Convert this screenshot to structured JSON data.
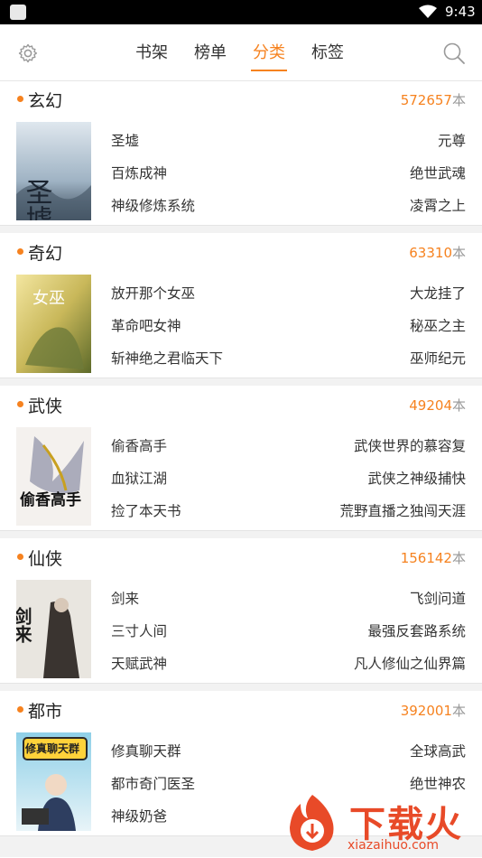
{
  "status_bar": {
    "time": "9:43"
  },
  "nav": {
    "tabs": [
      {
        "label": "书架"
      },
      {
        "label": "榜单"
      },
      {
        "label": "分类"
      },
      {
        "label": "标签"
      }
    ],
    "active_tab": "分类",
    "accent_color": "#f6821f"
  },
  "categories": [
    {
      "name": "玄幻",
      "count": "572657",
      "unit": "本",
      "cover_text": "圣墟",
      "books": [
        [
          "圣墟",
          "元尊"
        ],
        [
          "百炼成神",
          "绝世武魂"
        ],
        [
          "神级修炼系统",
          "凌霄之上"
        ]
      ]
    },
    {
      "name": "奇幻",
      "count": "63310",
      "unit": "本",
      "cover_text": "女巫",
      "books": [
        [
          "放开那个女巫",
          "大龙挂了"
        ],
        [
          "革命吧女神",
          "秘巫之主"
        ],
        [
          "斩神绝之君临天下",
          "巫师纪元"
        ]
      ]
    },
    {
      "name": "武侠",
      "count": "49204",
      "unit": "本",
      "cover_text": "偷香高手",
      "books": [
        [
          "偷香高手",
          "武侠世界的慕容复"
        ],
        [
          "血狱江湖",
          "武侠之神级捕快"
        ],
        [
          "捡了本天书",
          "荒野直播之独闯天涯"
        ]
      ]
    },
    {
      "name": "仙侠",
      "count": "156142",
      "unit": "本",
      "cover_text": "剑来",
      "books": [
        [
          "剑来",
          "飞剑问道"
        ],
        [
          "三寸人间",
          "最强反套路系统"
        ],
        [
          "天赋武神",
          "凡人修仙之仙界篇"
        ]
      ]
    },
    {
      "name": "都市",
      "count": "392001",
      "unit": "本",
      "cover_text": "修真聊天群",
      "books": [
        [
          "修真聊天群",
          "全球高武"
        ],
        [
          "都市奇门医圣",
          "绝世神农"
        ],
        [
          "神级奶爸",
          ""
        ]
      ]
    }
  ],
  "watermark": {
    "brand": "下载火",
    "url": "xiazaihuo.com"
  }
}
